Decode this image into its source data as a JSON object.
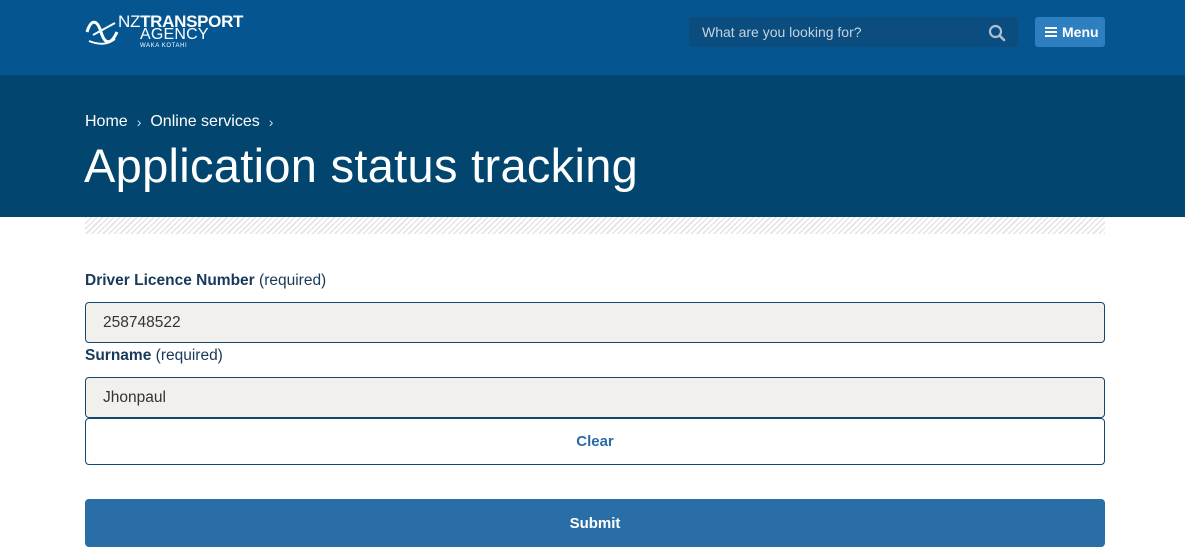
{
  "header": {
    "logo": {
      "line1_prefix": "NZ",
      "line1_bold": "TRANSPORT",
      "line2": "AGENCY",
      "line3": "WAKA KOTAHI"
    },
    "search": {
      "placeholder": "What are you looking for?",
      "icon": "search-icon"
    },
    "menu": {
      "label": "Menu",
      "icon": "hamburger-icon"
    }
  },
  "banner": {
    "breadcrumb": [
      "Home",
      "Online services"
    ],
    "separator": "›",
    "title": "Application status tracking"
  },
  "form": {
    "licence": {
      "label": "Driver Licence Number",
      "required_text": "(required)",
      "value": "258748522"
    },
    "surname": {
      "label": "Surname",
      "required_text": "(required)",
      "value": "Jhonpaul"
    },
    "clear_label": "Clear",
    "submit_label": "Submit"
  },
  "colors": {
    "header_bg": "#055591",
    "banner_bg": "#02466f",
    "submit_bg": "#2a6ea8",
    "field_bg": "#f2f0ec"
  }
}
